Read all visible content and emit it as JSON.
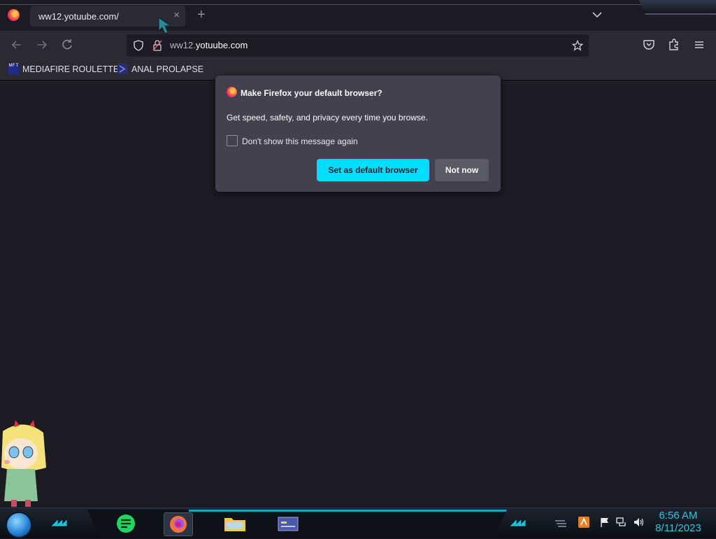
{
  "browser": {
    "tab_title": "ww12.yotuube.com/",
    "tab_close_glyph": "×",
    "new_tab_glyph": "+",
    "url_prefix": "ww12.",
    "url_domain": "yotuube.com"
  },
  "bookmarks": [
    {
      "label": "MEDIAFIRE ROULETTER",
      "icon_text": "MF T"
    },
    {
      "label": "ANAL PROLAPSE",
      "icon_text": ""
    }
  ],
  "dialog": {
    "title": "Make Firefox your default browser?",
    "body": "Get speed, safety, and privacy every time you browse.",
    "checkbox_label": "Don't show this message again",
    "checkbox_checked": false,
    "primary_button": "Set as default browser",
    "secondary_button": "Not now"
  },
  "taskbar": {
    "time": "6:56 AM",
    "date": "8/11/2023"
  },
  "colors": {
    "accent": "#00ddff",
    "browser_bg": "#1c1b22",
    "toolbar": "#2b2a33",
    "clock": "#28c8e0"
  }
}
